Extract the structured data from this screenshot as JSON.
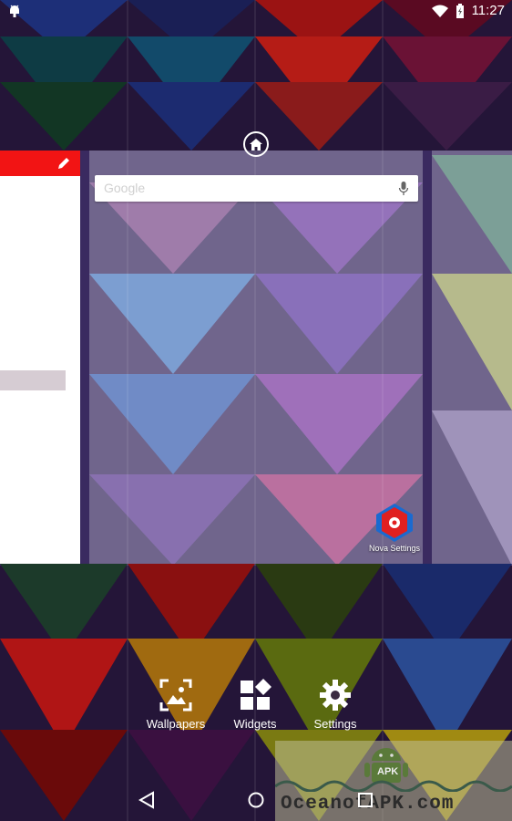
{
  "status_bar": {
    "time": "11:27",
    "icons": [
      "android-debug-icon",
      "wifi-icon",
      "battery-charging-icon"
    ]
  },
  "search": {
    "placeholder": "Google",
    "mic_icon": "mic-icon"
  },
  "home_indicator_icon": "home-icon",
  "apps": [
    {
      "label": "Nova Settings",
      "icon": "nova-settings-icon"
    }
  ],
  "actions": [
    {
      "label": "Wallpapers",
      "icon": "wallpapers-icon"
    },
    {
      "label": "Widgets",
      "icon": "widgets-icon"
    },
    {
      "label": "Settings",
      "icon": "gear-icon"
    }
  ],
  "nav": [
    "back-icon",
    "home-icon",
    "recent-apps-icon"
  ],
  "watermark": {
    "text": "OceanofAPK.com",
    "badge": "APK"
  },
  "colors": {
    "left_page_accent": "#f21414",
    "panel_overlay": "rgba(255,255,255,0.28)"
  }
}
